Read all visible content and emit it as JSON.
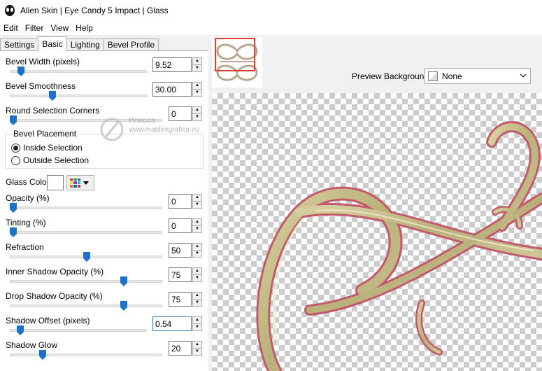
{
  "window": {
    "title": "Alien Skin | Eye Candy 5 Impact | Glass"
  },
  "menu": [
    "Edit",
    "Filter",
    "View",
    "Help"
  ],
  "tabs": [
    {
      "label": "Settings",
      "active": false
    },
    {
      "label": "Basic",
      "active": true
    },
    {
      "label": "Lighting",
      "active": false
    },
    {
      "label": "Bevel Profile",
      "active": false
    }
  ],
  "controls": {
    "bevel_width": {
      "label": "Bevel Width (pixels)",
      "value": "9.52"
    },
    "bevel_smoothness": {
      "label": "Bevel Smoothness",
      "value": "30.00"
    },
    "round_corners": {
      "label": "Round Selection Corners",
      "value": "0"
    },
    "bevel_placement": {
      "title": "Bevel Placement",
      "inside": "Inside Selection",
      "outside": "Outside Selection",
      "selected": "inside"
    },
    "glass_color": {
      "label": "Glass Color",
      "value": "#ffffff"
    },
    "opacity": {
      "label": "Opacity (%)",
      "value": "0"
    },
    "tinting": {
      "label": "Tinting (%)",
      "value": "0"
    },
    "refraction": {
      "label": "Refraction",
      "value": "50"
    },
    "inner_shadow": {
      "label": "Inner Shadow Opacity (%)",
      "value": "75"
    },
    "drop_shadow": {
      "label": "Drop Shadow Opacity (%)",
      "value": "75"
    },
    "shadow_offset": {
      "label": "Shadow Offset (pixels)",
      "value": "0.54"
    },
    "shadow_glow": {
      "label": "Shadow Glow",
      "value": "20"
    }
  },
  "preview": {
    "background_label": "Preview Background:",
    "background_value": "None"
  },
  "watermark": {
    "line1": "Pinuccia",
    "line2": "www.maidiregrafica.eu"
  },
  "colors": {
    "slider_thumb": "#1a73c8",
    "thumb_frame": "#e03c31",
    "glass": "#c8c08a",
    "outline": "#d06a7a"
  }
}
